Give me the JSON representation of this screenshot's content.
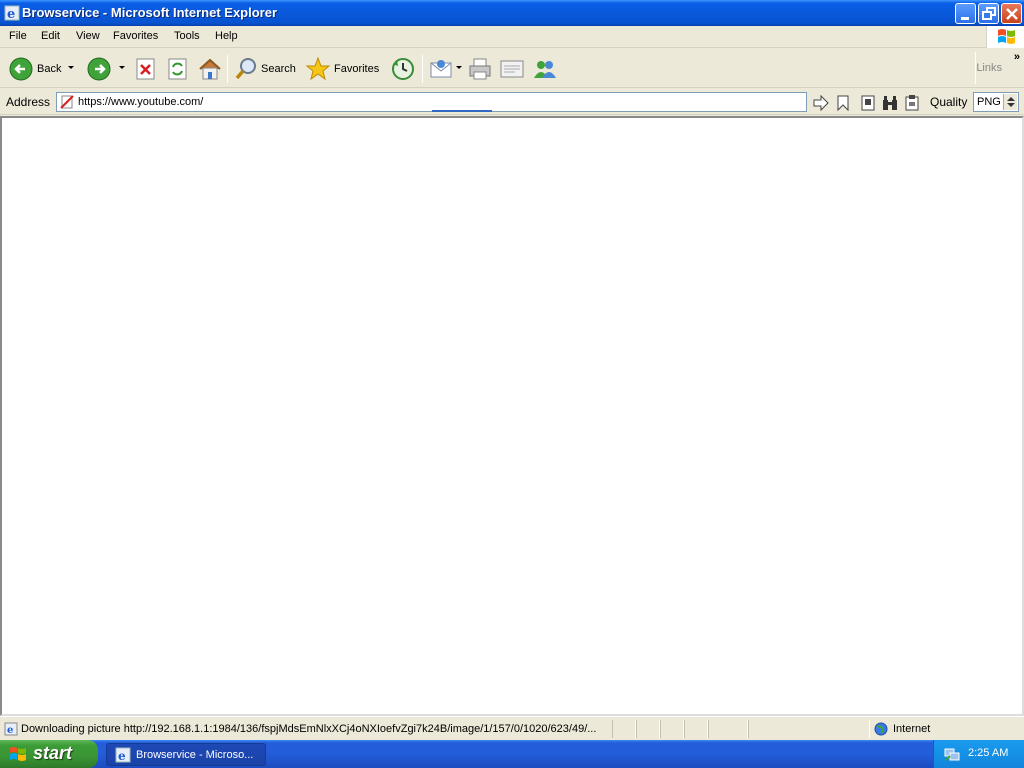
{
  "window": {
    "title": "Browservice - Microsoft Internet Explorer"
  },
  "menu": {
    "items": [
      "File",
      "Edit",
      "View",
      "Favorites",
      "Tools",
      "Help"
    ]
  },
  "toolbar": {
    "back_label": "Back",
    "search_label": "Search",
    "favorites_label": "Favorites",
    "links_label": "Links",
    "chevron": "»"
  },
  "address": {
    "label": "Address",
    "url": "https://www.youtube.com/",
    "quality_label": "Quality",
    "quality_value": "PNG"
  },
  "status": {
    "text": "Downloading picture http://192.168.1.1:1984/136/fspjMdsEmNlxXCj4oNXIoefvZgi7k24B/image/1/157/0/1020/623/49/...",
    "zone": "Internet"
  },
  "taskbar": {
    "start_label": "start",
    "task_label": "Browservice - Microso...",
    "clock": "2:25 AM"
  },
  "colors": {
    "title_blue": "#0a58dc",
    "start_green": "#3a9435",
    "taskbar_blue": "#235dd9",
    "chrome_beige": "#ece9d8"
  }
}
